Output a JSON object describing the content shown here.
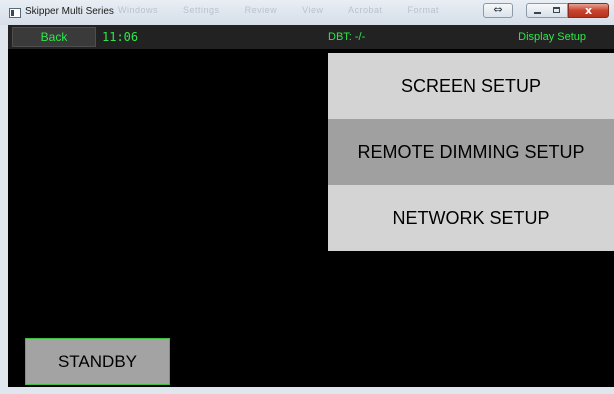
{
  "window": {
    "title": "Skipper Multi Series",
    "ghost_menu": [
      "Windows",
      "Settings",
      "Review",
      "View",
      "Acrobat",
      "Format"
    ],
    "controls": {
      "restore_symbol": "⇔",
      "close_symbol": "x"
    }
  },
  "topbar": {
    "back_label": "Back",
    "time": "11:06",
    "dbt": "DBT: -/-",
    "section_title": "Display Setup"
  },
  "menu": {
    "items": [
      {
        "label": "SCREEN SETUP",
        "active": false
      },
      {
        "label": "REMOTE DIMMING SETUP",
        "active": true
      },
      {
        "label": "NETWORK SETUP",
        "active": false
      }
    ]
  },
  "standby_label": "STANDBY",
  "colors": {
    "accent_green": "#2ee84a",
    "menu_bg": "#d4d4d4",
    "menu_active_bg": "#a0a0a0",
    "screen_bg": "#000000"
  }
}
